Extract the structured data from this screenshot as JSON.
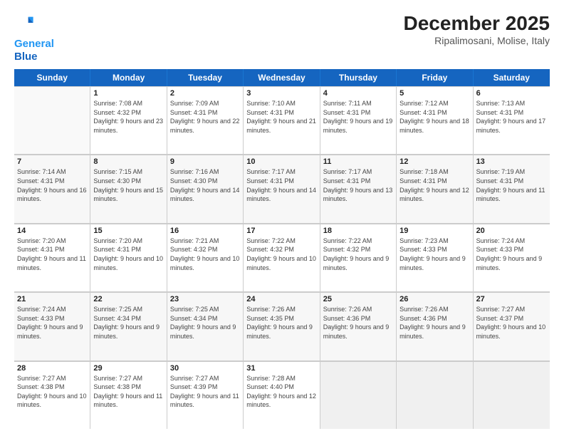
{
  "header": {
    "logo_line1": "General",
    "logo_line2": "Blue",
    "title": "December 2025",
    "subtitle": "Ripalimosani, Molise, Italy"
  },
  "calendar": {
    "days_of_week": [
      "Sunday",
      "Monday",
      "Tuesday",
      "Wednesday",
      "Thursday",
      "Friday",
      "Saturday"
    ],
    "weeks": [
      [
        {
          "day": "",
          "empty": true
        },
        {
          "day": "1",
          "sunrise": "7:08 AM",
          "sunset": "4:32 PM",
          "daylight": "9 hours and 23 minutes."
        },
        {
          "day": "2",
          "sunrise": "7:09 AM",
          "sunset": "4:31 PM",
          "daylight": "9 hours and 22 minutes."
        },
        {
          "day": "3",
          "sunrise": "7:10 AM",
          "sunset": "4:31 PM",
          "daylight": "9 hours and 21 minutes."
        },
        {
          "day": "4",
          "sunrise": "7:11 AM",
          "sunset": "4:31 PM",
          "daylight": "9 hours and 19 minutes."
        },
        {
          "day": "5",
          "sunrise": "7:12 AM",
          "sunset": "4:31 PM",
          "daylight": "9 hours and 18 minutes."
        },
        {
          "day": "6",
          "sunrise": "7:13 AM",
          "sunset": "4:31 PM",
          "daylight": "9 hours and 17 minutes."
        }
      ],
      [
        {
          "day": "7",
          "sunrise": "7:14 AM",
          "sunset": "4:31 PM",
          "daylight": "9 hours and 16 minutes."
        },
        {
          "day": "8",
          "sunrise": "7:15 AM",
          "sunset": "4:30 PM",
          "daylight": "9 hours and 15 minutes."
        },
        {
          "day": "9",
          "sunrise": "7:16 AM",
          "sunset": "4:30 PM",
          "daylight": "9 hours and 14 minutes."
        },
        {
          "day": "10",
          "sunrise": "7:17 AM",
          "sunset": "4:31 PM",
          "daylight": "9 hours and 14 minutes."
        },
        {
          "day": "11",
          "sunrise": "7:17 AM",
          "sunset": "4:31 PM",
          "daylight": "9 hours and 13 minutes."
        },
        {
          "day": "12",
          "sunrise": "7:18 AM",
          "sunset": "4:31 PM",
          "daylight": "9 hours and 12 minutes."
        },
        {
          "day": "13",
          "sunrise": "7:19 AM",
          "sunset": "4:31 PM",
          "daylight": "9 hours and 11 minutes."
        }
      ],
      [
        {
          "day": "14",
          "sunrise": "7:20 AM",
          "sunset": "4:31 PM",
          "daylight": "9 hours and 11 minutes."
        },
        {
          "day": "15",
          "sunrise": "7:20 AM",
          "sunset": "4:31 PM",
          "daylight": "9 hours and 10 minutes."
        },
        {
          "day": "16",
          "sunrise": "7:21 AM",
          "sunset": "4:32 PM",
          "daylight": "9 hours and 10 minutes."
        },
        {
          "day": "17",
          "sunrise": "7:22 AM",
          "sunset": "4:32 PM",
          "daylight": "9 hours and 10 minutes."
        },
        {
          "day": "18",
          "sunrise": "7:22 AM",
          "sunset": "4:32 PM",
          "daylight": "9 hours and 9 minutes."
        },
        {
          "day": "19",
          "sunrise": "7:23 AM",
          "sunset": "4:33 PM",
          "daylight": "9 hours and 9 minutes."
        },
        {
          "day": "20",
          "sunrise": "7:24 AM",
          "sunset": "4:33 PM",
          "daylight": "9 hours and 9 minutes."
        }
      ],
      [
        {
          "day": "21",
          "sunrise": "7:24 AM",
          "sunset": "4:33 PM",
          "daylight": "9 hours and 9 minutes."
        },
        {
          "day": "22",
          "sunrise": "7:25 AM",
          "sunset": "4:34 PM",
          "daylight": "9 hours and 9 minutes."
        },
        {
          "day": "23",
          "sunrise": "7:25 AM",
          "sunset": "4:34 PM",
          "daylight": "9 hours and 9 minutes."
        },
        {
          "day": "24",
          "sunrise": "7:26 AM",
          "sunset": "4:35 PM",
          "daylight": "9 hours and 9 minutes."
        },
        {
          "day": "25",
          "sunrise": "7:26 AM",
          "sunset": "4:36 PM",
          "daylight": "9 hours and 9 minutes."
        },
        {
          "day": "26",
          "sunrise": "7:26 AM",
          "sunset": "4:36 PM",
          "daylight": "9 hours and 9 minutes."
        },
        {
          "day": "27",
          "sunrise": "7:27 AM",
          "sunset": "4:37 PM",
          "daylight": "9 hours and 10 minutes."
        }
      ],
      [
        {
          "day": "28",
          "sunrise": "7:27 AM",
          "sunset": "4:38 PM",
          "daylight": "9 hours and 10 minutes."
        },
        {
          "day": "29",
          "sunrise": "7:27 AM",
          "sunset": "4:38 PM",
          "daylight": "9 hours and 11 minutes."
        },
        {
          "day": "30",
          "sunrise": "7:27 AM",
          "sunset": "4:39 PM",
          "daylight": "9 hours and 11 minutes."
        },
        {
          "day": "31",
          "sunrise": "7:28 AM",
          "sunset": "4:40 PM",
          "daylight": "9 hours and 12 minutes."
        },
        {
          "day": "",
          "empty": true
        },
        {
          "day": "",
          "empty": true
        },
        {
          "day": "",
          "empty": true
        }
      ]
    ]
  }
}
